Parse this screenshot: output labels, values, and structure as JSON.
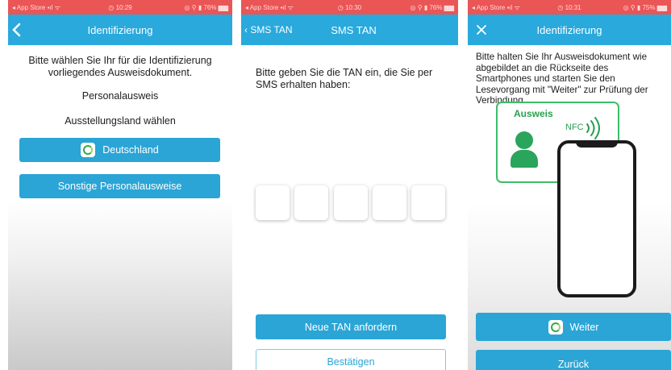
{
  "screens": [
    {
      "status": {
        "left": "◂ App Store ▪ıl ᯤ",
        "time": "◷ 10:29",
        "right": "◎ ⚲ ▮ 76% ▆▆"
      },
      "nav": {
        "back": "‹",
        "title": "Identifizierung"
      },
      "prompt": "Bitte wählen Sie Ihr für die Identifizierung vorliegendes Ausweisdokument.",
      "doc_type": "Personalausweis",
      "country_label": "Ausstellungsland wählen",
      "buttons": {
        "germany": "Deutschland",
        "other": "Sonstige Personalausweise"
      }
    },
    {
      "status": {
        "left": "◂ App Store ▪ıl ᯤ",
        "time": "◷ 10:30",
        "right": "◎ ⚲ ▮ 76% ▆▆"
      },
      "nav": {
        "back": "‹ SMS TAN",
        "title": "SMS TAN"
      },
      "prompt": "Bitte geben Sie die TAN ein, die Sie per SMS erhalten haben:",
      "tan_slots": 5,
      "buttons": {
        "new_tan": "Neue TAN anfordern",
        "confirm": "Bestätigen"
      }
    },
    {
      "status": {
        "left": "◂ App Store ▪ıl ᯤ",
        "time": "◷ 10:31",
        "right": "◎ ⚲ ▮ 75% ▆▆"
      },
      "nav": {
        "close": "✕",
        "title": "Identifizierung"
      },
      "prompt": "Bitte halten Sie Ihr Ausweisdokument wie abgebildet an die Rückseite des Smartphones und starten Sie den Lesevorgang mit \"Weiter\" zur Prüfung der Verbindung.",
      "illustration": {
        "card_label": "Ausweis",
        "nfc_label": "NFC"
      },
      "buttons": {
        "next": "Weiter",
        "back": "Zurück"
      }
    }
  ],
  "colors": {
    "status_bar": "#ea5556",
    "nav_bar": "#29a9dc",
    "button": "#2aa5d6",
    "accent_green": "#2aa55c"
  },
  "icons": {
    "back": "chevron-left-icon",
    "close": "close-icon",
    "nfc": "nfc-waves-icon",
    "person": "person-icon",
    "app_logo": "app-logo-icon"
  }
}
